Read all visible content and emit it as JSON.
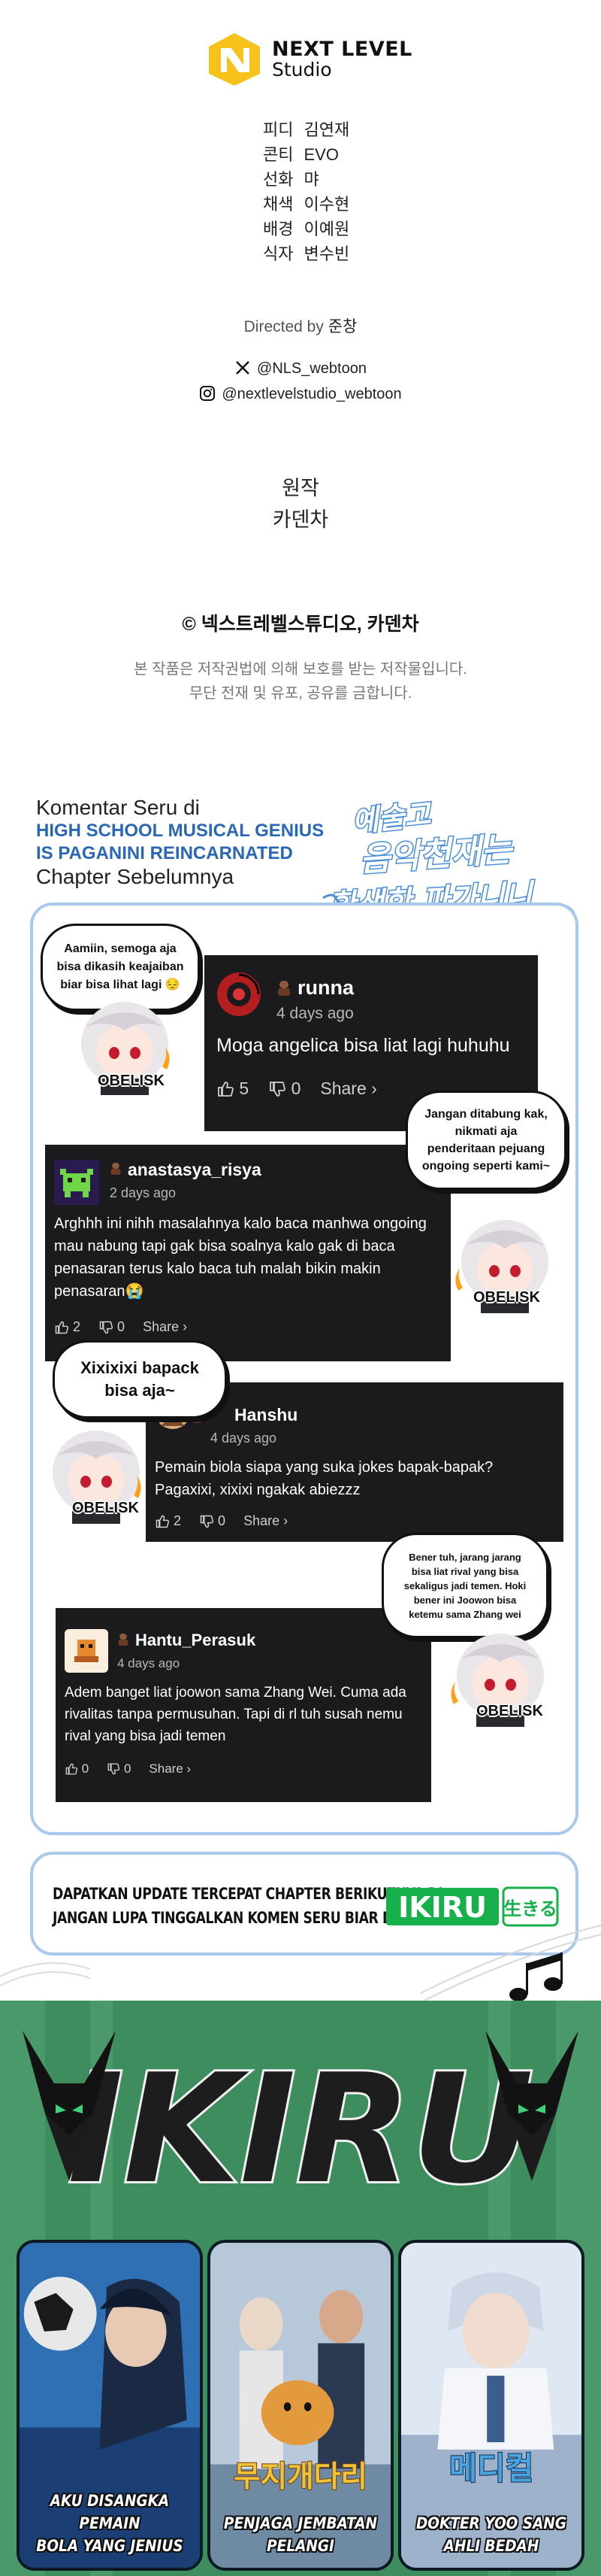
{
  "studio": {
    "name_line1": "NEXT LEVEL",
    "name_line2": "Studio",
    "brand_color": "#f7c21b"
  },
  "credits": [
    {
      "role": "피디",
      "name": "김연재"
    },
    {
      "role": "콘티",
      "name": "EVO"
    },
    {
      "role": "선화",
      "name": "먀"
    },
    {
      "role": "채색",
      "name": "이수현"
    },
    {
      "role": "배경",
      "name": "이예원"
    },
    {
      "role": "식자",
      "name": "변수빈"
    }
  ],
  "directed": {
    "label": "Directed by",
    "name": "준창"
  },
  "social": {
    "x_handle": "@NLS_webtoon",
    "instagram_handle": "@nextlevelstudio_webtoon"
  },
  "original": {
    "label": "원작",
    "author": "카덴차"
  },
  "copyright": "© 넥스트레벨스튜디오, 카덴차",
  "rights": {
    "line1": "본 작품은 저작권법에 의해 보호를 받는 저작물입니다.",
    "line2": "무단 전재 및 유포, 공유를 금합니다."
  },
  "comments_section": {
    "heading_prefix": "Komentar Seru di",
    "series_title_line1": "HIGH SCHOOL MUSICAL GENIUS",
    "series_title_line2": "IS PAGANINI REINCARNATED",
    "heading_suffix": "Chapter Sebelumnya",
    "korean_logo_line1": "예술고",
    "korean_logo_line2": "음악천재는",
    "korean_logo_line3": "환생한 파가니니",
    "accent_color": "#2b67b7",
    "panel_border_color": "#a8c8ec"
  },
  "comments": [
    {
      "user": "runna",
      "time": "4 days ago",
      "text": "Moga angelica bisa liat lagi huhuhu",
      "likes": "5",
      "dislikes": "0",
      "share": "Share ›"
    },
    {
      "user": "anastasya_risya",
      "time": "2 days ago",
      "text": "Arghhh ini nihh masalahnya kalo baca manhwa ongoing mau nabung tapi gak bisa soalnya kalo gak di baca penasaran terus kalo baca tuh malah bikin makin penasaran😭",
      "likes": "2",
      "dislikes": "0",
      "share": "Share ›"
    },
    {
      "user": "Hanshu",
      "time": "4 days ago",
      "text": "Pemain biola siapa yang suka jokes bapak-bapak? Pagaxixi, xixixi ngakak abiezzz",
      "likes": "2",
      "dislikes": "0",
      "share": "Share ›"
    },
    {
      "user": "Hantu_Perasuk",
      "time": "4 days ago",
      "text": "Adem banget liat joowon sama Zhang Wei. Cuma ada rivalitas tanpa permusuhan. Tapi di rl tuh susah nemu rival yang bisa jadi temen",
      "likes": "0",
      "dislikes": "0",
      "share": "Share ›"
    }
  ],
  "bubbles": [
    {
      "text": "Aamiin, semoga aja bisa dikasih keajaiban biar bisa lihat lagi 😔"
    },
    {
      "text": "Jangan ditabung kak, nikmati aja penderitaan pejuang ongoing seperti kami~"
    },
    {
      "text": "Xixixixi bapack bisa aja~"
    },
    {
      "text": "Bener tuh, jarang jarang bisa liat rival yang bisa sekaligus jadi temen. Hoki bener ini Joowon bisa ketemu sama Zhang wei"
    }
  ],
  "mascot_caption": "OBELISK",
  "banner": {
    "line1": "DAPATKAN UPDATE TERCEPAT CHAPTER BERIKUTNYA DI",
    "line2": "JANGAN LUPA TINGGALKAN KOMEN SERU BIAR DI NOTIS",
    "brand": "IKIRU",
    "brand_jp": "生きる",
    "brand_color": "#17b04a"
  },
  "ikiru": {
    "title": "IKIRU",
    "bg_color": "#3e8d5e",
    "cards": [
      {
        "label_line1": "AKU DISANGKA PEMAIN",
        "label_line2": "BOLA YANG JENIUS"
      },
      {
        "label_line1": "PENJAGA JEMBATAN",
        "label_line2": "PELANGI",
        "art_text": "무지개다리"
      },
      {
        "label_line1": "DOKTER YOO SANG",
        "label_line2": "AHLI BEDAH",
        "art_text": "메디컬"
      }
    ]
  }
}
